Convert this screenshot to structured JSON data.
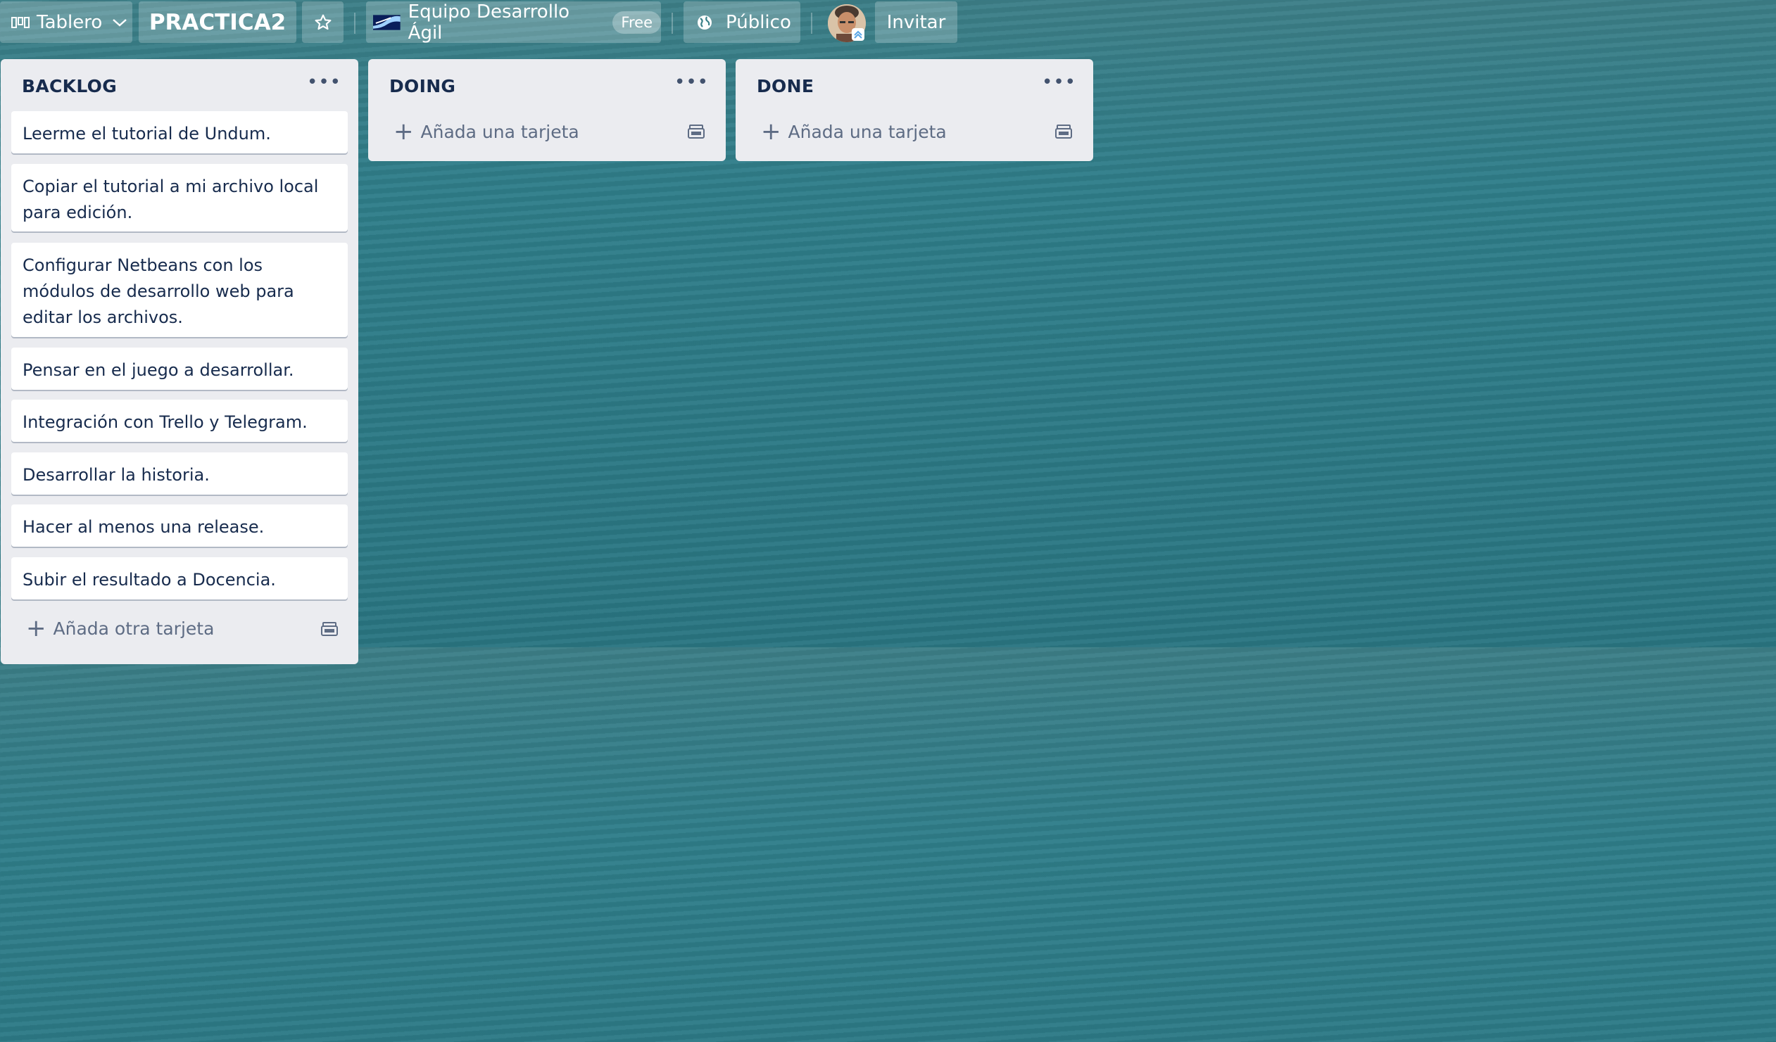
{
  "header": {
    "board_view_label": "Tablero",
    "board_title": "PRACTICA2",
    "workspace_name": "Equipo Desarrollo Ágil",
    "plan_badge": "Free",
    "visibility_label": "Público",
    "invite_label": "Invitar",
    "icons": [
      "board-icon",
      "chevron-down-icon",
      "star-icon",
      "workspace-logo",
      "globe-icon",
      "avatar"
    ]
  },
  "lists": [
    {
      "title": "BACKLOG",
      "cards": [
        "Leerme el tutorial de Undum.",
        "Copiar el tutorial a mi archivo local para edición.",
        "Configurar Netbeans con los módulos de desarrollo web para editar los archivos.",
        "Pensar en el juego a desarrollar.",
        "Integración con Trello y Telegram.",
        "Desarrollar la historia.",
        "Hacer al menos una release.",
        "Subir el resultado a Docencia."
      ],
      "add_label": "Añada otra tarjeta"
    },
    {
      "title": "DOING",
      "cards": [],
      "add_label": "Añada una tarjeta"
    },
    {
      "title": "DONE",
      "cards": [],
      "add_label": "Añada una tarjeta"
    }
  ],
  "colors": {
    "accent_text": "#172b4d",
    "list_bg": "#ebecf0",
    "board_bg": "#2f7e8a"
  }
}
